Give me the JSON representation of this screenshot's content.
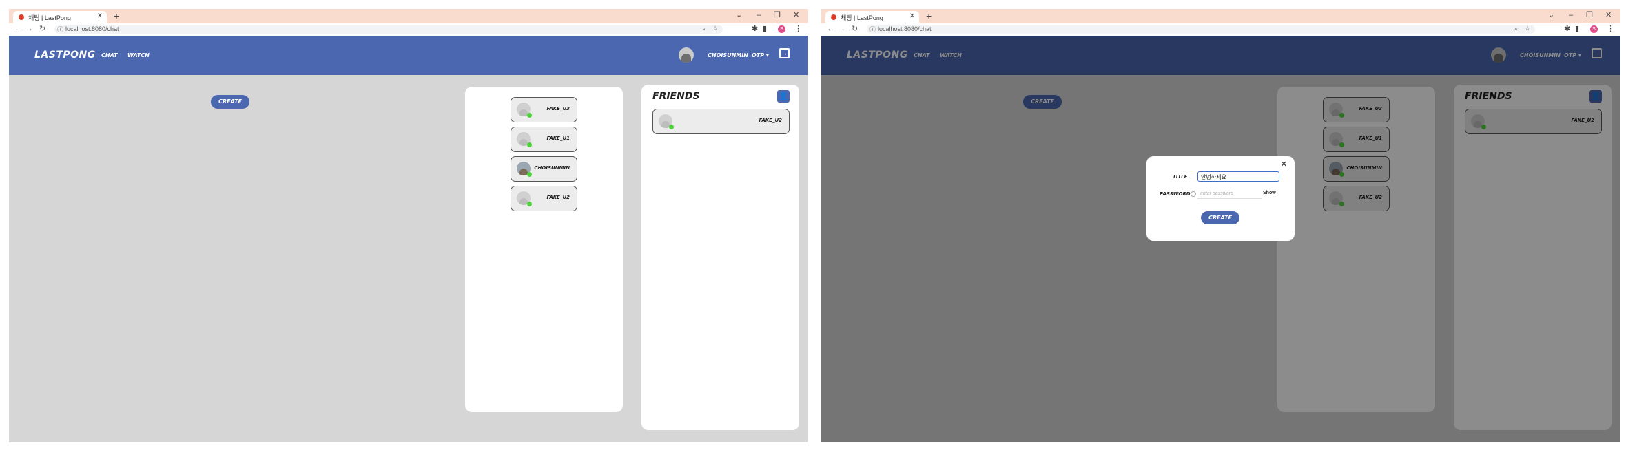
{
  "colors": {
    "header": "#4a67b0",
    "content_bg": "#d6d6d6",
    "tabbar": "#f9dccd",
    "online": "#4fd23c"
  },
  "browser": {
    "tab_title": "채팅 | LastPong",
    "url": "localhost:8080/chat"
  },
  "app": {
    "logo": "LASTPONG",
    "nav": [
      "CHAT",
      "WATCH"
    ],
    "username": "CHOISUNMIN",
    "otp": "OTP ▾",
    "create_label": "CREATE",
    "users": [
      "FAKE_U3",
      "FAKE_U1",
      "CHOISUNMIN",
      "FAKE_U2"
    ],
    "friends_title": "FRIENDS",
    "friends": [
      "FAKE_U2"
    ]
  },
  "modal": {
    "title_label": "TITLE",
    "title_value": "안녕하세요",
    "password_label": "PASSWORD",
    "password_placeholder": "enter password",
    "show_label": "Show",
    "create_label": "CREATE"
  }
}
